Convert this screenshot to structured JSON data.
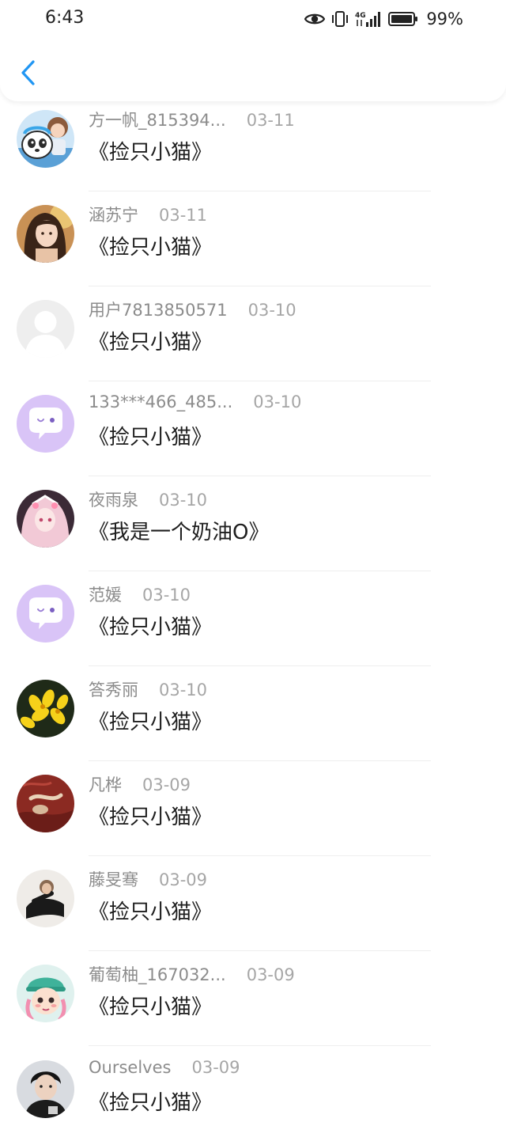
{
  "status_bar": {
    "time": "6:43",
    "battery": "99%",
    "icons": [
      "eye-icon",
      "vibrate-icon",
      "signal-4g-icon",
      "battery-icon"
    ]
  },
  "nav": {
    "back_icon": "chevron-left-icon",
    "accent_color": "#2196f3"
  },
  "comments": [
    {
      "user": "方一帆_815394...",
      "date": "03-11",
      "title": "《捡只小猫》",
      "avatar": "panda-illustration"
    },
    {
      "user": "涵苏宁",
      "date": "03-11",
      "title": "《捡只小猫》",
      "avatar": "girl-illustration"
    },
    {
      "user": "用户7813850571",
      "date": "03-10",
      "title": "《捡只小猫》",
      "avatar": "default-gray"
    },
    {
      "user": "133***466_485...",
      "date": "03-10",
      "title": "《捡只小猫》",
      "avatar": "default-chat-bubble"
    },
    {
      "user": "夜雨泉",
      "date": "03-10",
      "title": "《我是一个奶油O》",
      "avatar": "anime-girl"
    },
    {
      "user": "范媛",
      "date": "03-10",
      "title": "《捡只小猫》",
      "avatar": "default-chat-bubble"
    },
    {
      "user": "答秀丽",
      "date": "03-10",
      "title": "《捡只小猫》",
      "avatar": "yellow-flowers"
    },
    {
      "user": "凡桦",
      "date": "03-09",
      "title": "《捡只小猫》",
      "avatar": "red-painting"
    },
    {
      "user": "藤旻骞",
      "date": "03-09",
      "title": "《捡只小猫》",
      "avatar": "photo-person"
    },
    {
      "user": "葡萄柚_167032...",
      "date": "03-09",
      "title": "《捡只小猫》",
      "avatar": "cartoon-girl"
    },
    {
      "user": "Ourselves",
      "date": "03-09",
      "title": "《捡只小猫》",
      "avatar": "photo-boy"
    }
  ]
}
